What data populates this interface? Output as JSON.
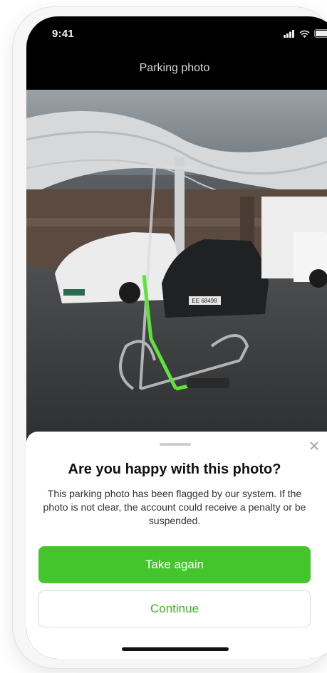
{
  "status_bar": {
    "time": "9:41",
    "signal_icon": "signal-icon",
    "wifi_icon": "wifi-icon",
    "battery_icon": "battery-icon"
  },
  "header": {
    "title": "Parking photo"
  },
  "photo": {
    "plate_text": "EE 68498"
  },
  "sheet": {
    "title": "Are you happy with this photo?",
    "body": "This parking photo has been flagged by our system. If the photo is not clear, the account could receive a penalty or be suspended.",
    "primary_button": "Take again",
    "secondary_button": "Continue"
  },
  "colors": {
    "accent": "#45c52c",
    "accent_text": "#3fb224"
  }
}
